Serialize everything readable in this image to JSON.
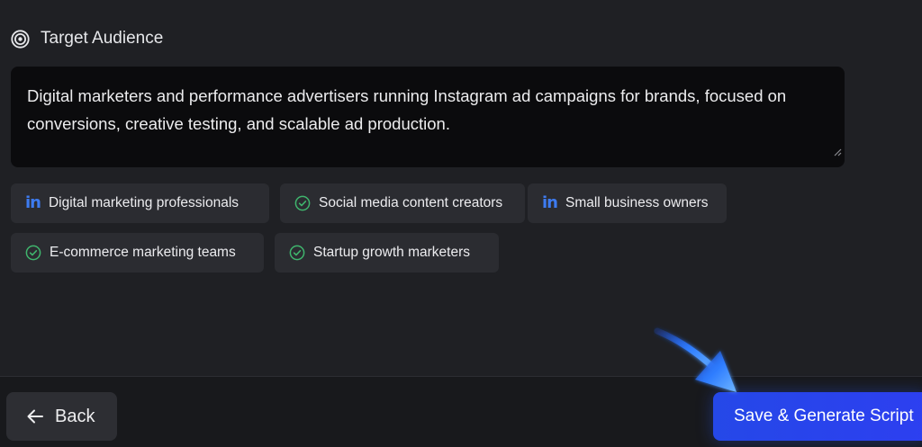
{
  "section": {
    "title": "Target Audience",
    "icon": "target-icon"
  },
  "audience_input": {
    "value": "Digital marketers and performance advertisers running Instagram ad campaigns for brands, focused on conversions, creative testing, and scalable ad production."
  },
  "suggestions": [
    {
      "label": "Digital marketing professionals",
      "icon": "linkedin-icon"
    },
    {
      "label": "Social media content creators",
      "icon": "check-circle-icon"
    },
    {
      "label": "Small business owners",
      "icon": "linkedin-icon"
    },
    {
      "label": "E-commerce marketing teams",
      "icon": "check-circle-icon"
    },
    {
      "label": "Startup growth marketers",
      "icon": "check-circle-icon"
    }
  ],
  "footer": {
    "back_label": "Back",
    "primary_label": "Save & Generate Script"
  },
  "colors": {
    "background": "#1f2024",
    "input_background": "#0b0b0d",
    "tag_background": "#2b2c31",
    "check_green": "#3fb56d",
    "linkedin_blue": "#3d7bf0",
    "primary_button": "#2a44ec"
  }
}
